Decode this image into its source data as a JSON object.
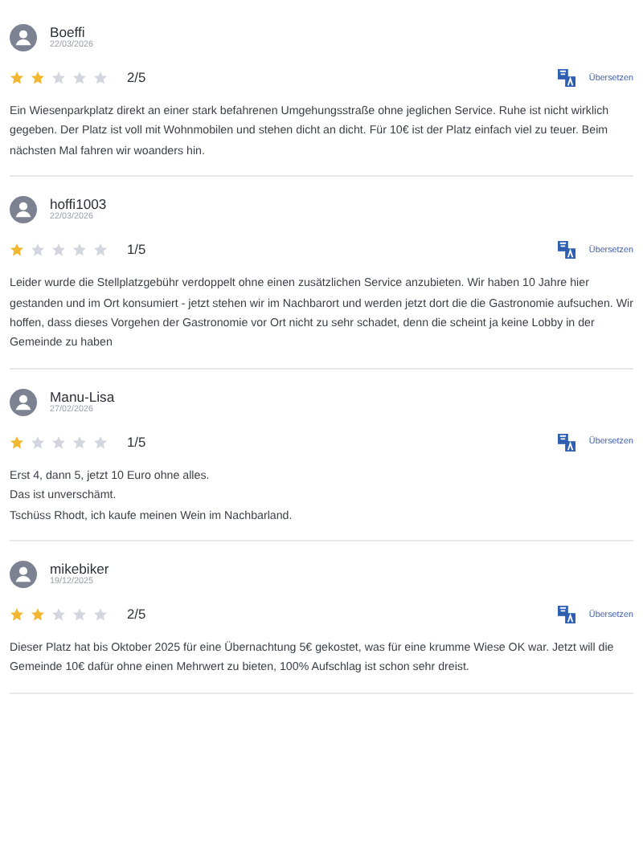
{
  "reviews": [
    {
      "author": "Boeffi",
      "date": "22/03/2026",
      "stars": 2,
      "score": "2/5",
      "translate": "Übersetzen",
      "text": [
        "Ein Wiesenparkplatz direkt an einer stark befahrenen Umgehungsstraße ohne jeglichen Service. Ruhe ist nicht wirklich gegeben. Der Platz ist voll mit Wohnmobilen und stehen dicht an dicht. Für 10€ ist der Platz einfach viel zu teuer. Beim nächsten Mal fahren wir woanders hin."
      ]
    },
    {
      "author": "hoffi1003",
      "date": "22/03/2026",
      "stars": 1,
      "score": "1/5",
      "translate": "Übersetzen",
      "text": [
        "Leider wurde die Stellplatzgebühr verdoppelt ohne einen zusätzlichen Service anzubieten. Wir haben 10 Jahre hier gestanden und im Ort konsumiert - jetzt stehen wir im Nachbarort und werden jetzt dort die die Gastronomie aufsuchen. Wir hoffen, dass dieses Vorgehen der Gastronomie vor Ort nicht zu sehr schadet, denn die scheint ja keine Lobby in der Gemeinde zu haben"
      ]
    },
    {
      "author": "Manu-Lisa",
      "date": "27/02/2026",
      "stars": 1,
      "score": "1/5",
      "translate": "Übersetzen",
      "text": [
        "Erst 4, dann 5, jetzt 10 Euro ohne alles.",
        "Das ist unverschämt.",
        "Tschüss Rhodt, ich kaufe meinen Wein im Nachbarland."
      ]
    },
    {
      "author": "mikebiker",
      "date": "19/12/2025",
      "stars": 2,
      "score": "2/5",
      "translate": "Übersetzen",
      "text": [
        "Dieser Platz hat bis Oktober 2025 für eine Übernachtung 5€ gekostet, was für eine krumme Wiese OK war. Jetzt will die Gemeinde 10€ dafür ohne einen Mehrwert zu bieten, 100% Aufschlag ist schon sehr dreist."
      ]
    }
  ]
}
